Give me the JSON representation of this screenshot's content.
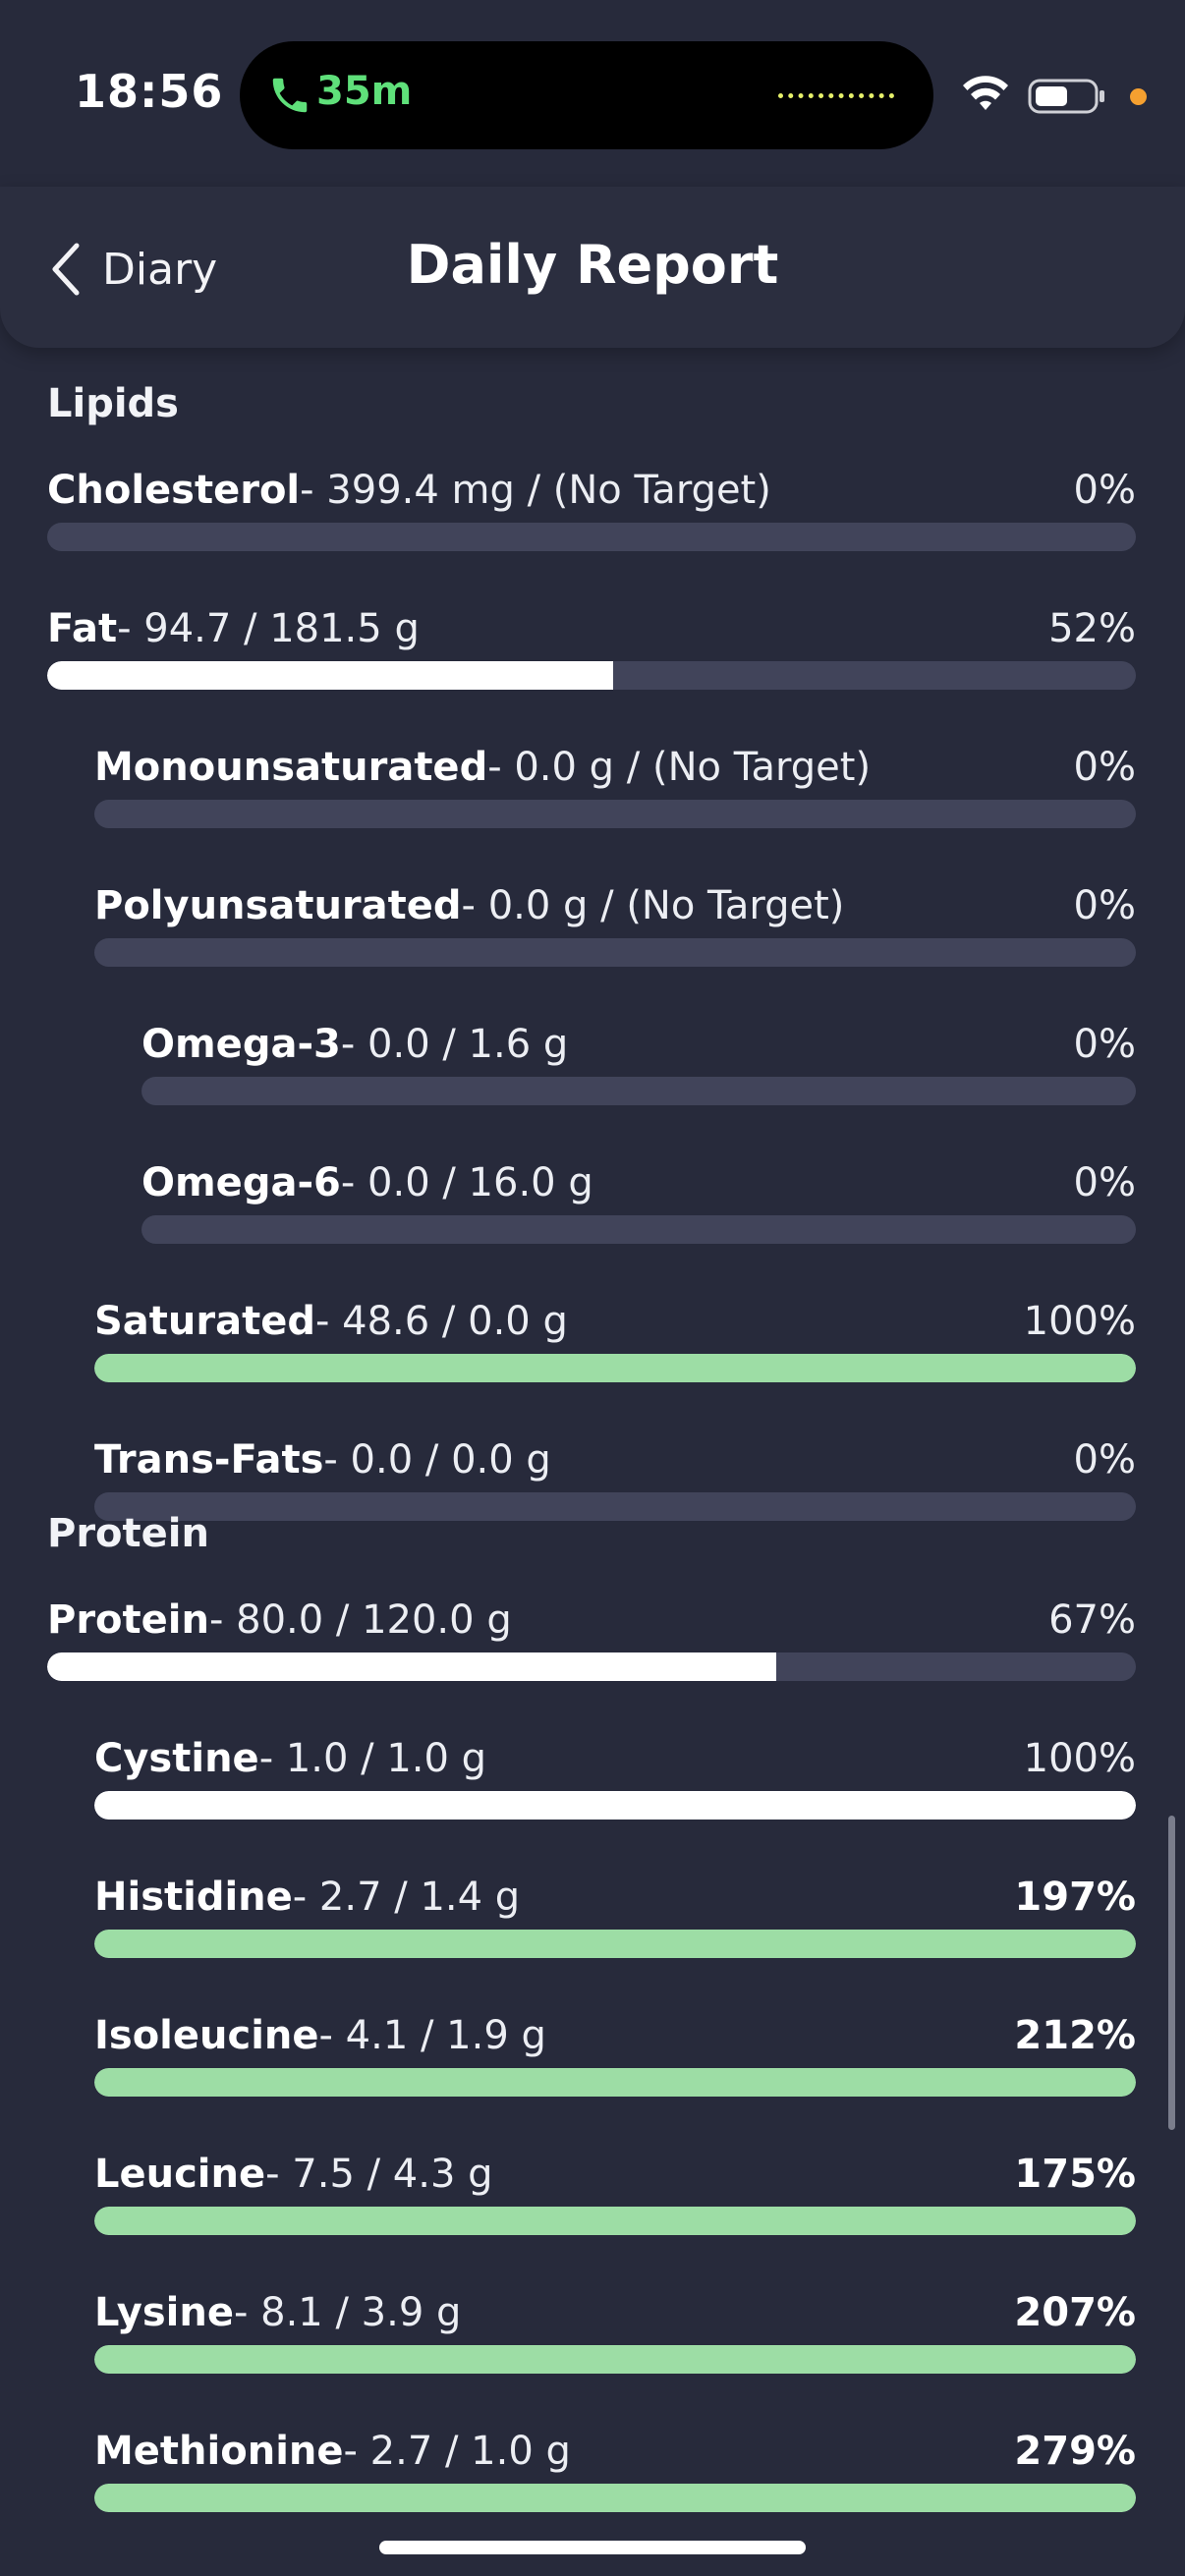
{
  "status_bar": {
    "time": "18:56",
    "call_duration": "35m"
  },
  "nav": {
    "back_label": "Diary",
    "title": "Daily Report"
  },
  "colors": {
    "background": "#272a3b",
    "track": "#41445a",
    "fill_white": "#ffffff",
    "fill_green": "#9ddda5",
    "call_green": "#5fe07a",
    "orange_dot": "#f5a030"
  },
  "sections": [
    {
      "title": "Lipids",
      "rows": [
        {
          "name": "Cholesterol",
          "detail": "- 399.4 mg / (No Target)",
          "percent": "0%",
          "level": 0,
          "fill": 0,
          "color": "white",
          "bold_pct": false
        },
        {
          "name": "Fat",
          "detail": "- 94.7 / 181.5 g",
          "percent": "52%",
          "level": 0,
          "fill": 0.52,
          "color": "white",
          "bold_pct": false
        },
        {
          "name": "Monounsaturated",
          "detail": "- 0.0 g / (No Target)",
          "percent": "0%",
          "level": 1,
          "fill": 0,
          "color": "white",
          "bold_pct": false
        },
        {
          "name": "Polyunsaturated",
          "detail": "- 0.0 g / (No Target)",
          "percent": "0%",
          "level": 1,
          "fill": 0,
          "color": "white",
          "bold_pct": false
        },
        {
          "name": "Omega-3",
          "detail": "- 0.0 / 1.6 g",
          "percent": "0%",
          "level": 2,
          "fill": 0,
          "color": "white",
          "bold_pct": false
        },
        {
          "name": "Omega-6",
          "detail": "- 0.0 / 16.0 g",
          "percent": "0%",
          "level": 2,
          "fill": 0,
          "color": "white",
          "bold_pct": false
        },
        {
          "name": "Saturated",
          "detail": "- 48.6 / 0.0 g",
          "percent": "100%",
          "level": 1,
          "fill": 1,
          "color": "green",
          "bold_pct": false
        },
        {
          "name": "Trans-Fats",
          "detail": "- 0.0 / 0.0 g",
          "percent": "0%",
          "level": 1,
          "fill": 0,
          "color": "white",
          "bold_pct": false
        }
      ]
    },
    {
      "title": "Protein",
      "rows": [
        {
          "name": "Protein",
          "detail": "- 80.0 / 120.0 g",
          "percent": "67%",
          "level": 0,
          "fill": 0.67,
          "color": "white",
          "bold_pct": false
        },
        {
          "name": "Cystine",
          "detail": "- 1.0 / 1.0 g",
          "percent": "100%",
          "level": 1,
          "fill": 1,
          "color": "white",
          "bold_pct": false
        },
        {
          "name": "Histidine",
          "detail": "- 2.7 / 1.4 g",
          "percent": "197%",
          "level": 1,
          "fill": 1,
          "color": "green",
          "bold_pct": true
        },
        {
          "name": "Isoleucine",
          "detail": "- 4.1 / 1.9 g",
          "percent": "212%",
          "level": 1,
          "fill": 1,
          "color": "green",
          "bold_pct": true
        },
        {
          "name": "Leucine",
          "detail": "- 7.5 / 4.3 g",
          "percent": "175%",
          "level": 1,
          "fill": 1,
          "color": "green",
          "bold_pct": true
        },
        {
          "name": "Lysine",
          "detail": "- 8.1 / 3.9 g",
          "percent": "207%",
          "level": 1,
          "fill": 1,
          "color": "green",
          "bold_pct": true
        },
        {
          "name": "Methionine",
          "detail": "- 2.7 / 1.0 g",
          "percent": "279%",
          "level": 1,
          "fill": 1,
          "color": "green",
          "bold_pct": true
        }
      ]
    }
  ]
}
